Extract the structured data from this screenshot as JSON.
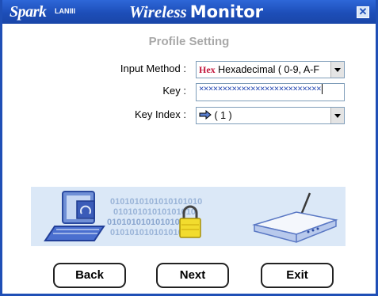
{
  "titlebar": {
    "brand": "Sparkℒ",
    "brand_suffix": "LANIII",
    "title_part1": "Wireless",
    "title_part2": "Monitor",
    "close_symbol": "✕"
  },
  "page": {
    "subtitle": "Profile Setting"
  },
  "form": {
    "input_method": {
      "label": "Input Method :",
      "icon": "Hex",
      "value": "Hexadecimal ( 0-9, A-F"
    },
    "key": {
      "label": "Key :",
      "value": "××××××××××××××××××××××××××"
    },
    "key_index": {
      "label": "Key Index :",
      "value": "( 1 )"
    }
  },
  "banner": {
    "binary": [
      "0101010101010101010",
      "01010101010101010",
      "0101010101010101",
      "01010101010101010"
    ]
  },
  "buttons": {
    "back": "Back",
    "next": "Next",
    "exit": "Exit"
  },
  "colors": {
    "titlebar": "#1d4eb8",
    "banner": "#dbe8f7",
    "hex_icon": "#c2143a"
  }
}
